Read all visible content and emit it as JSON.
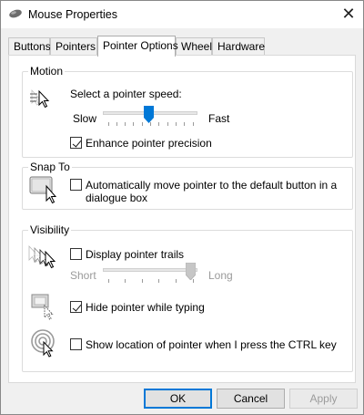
{
  "window": {
    "title": "Mouse Properties",
    "close_glyph": "✕"
  },
  "tabs": [
    {
      "label": "Buttons"
    },
    {
      "label": "Pointers"
    },
    {
      "label": "Pointer Options",
      "active": true
    },
    {
      "label": "Wheel"
    },
    {
      "label": "Hardware"
    }
  ],
  "motion": {
    "group_title": "Motion",
    "prompt": "Select a pointer speed:",
    "slow_label": "Slow",
    "fast_label": "Fast",
    "speed_fraction": 0.48,
    "enhance_label": "Enhance pointer precision",
    "enhance_checked": true
  },
  "snap_to": {
    "group_title": "Snap To",
    "label_line1": "Automatically move pointer to the default button in a",
    "label_line2": "dialogue box",
    "checked": false
  },
  "visibility": {
    "group_title": "Visibility",
    "trails_label": "Display pointer trails",
    "trails_checked": false,
    "short_label": "Short",
    "long_label": "Long",
    "trail_fraction": 0.98,
    "hide_label": "Hide pointer while typing",
    "hide_checked": true,
    "show_location_label": "Show location of pointer when I press the CTRL key",
    "show_location_checked": false
  },
  "buttons": {
    "ok": "OK",
    "cancel": "Cancel",
    "apply": "Apply"
  },
  "colors": {
    "accent": "#0078d7"
  },
  "icons": {
    "app": "mouse-icon",
    "motion": "pointer-speed-icon",
    "snap": "snap-to-button-icon",
    "trails": "pointer-trails-icon",
    "hide": "hide-pointer-icon",
    "location": "pointer-location-icon"
  }
}
